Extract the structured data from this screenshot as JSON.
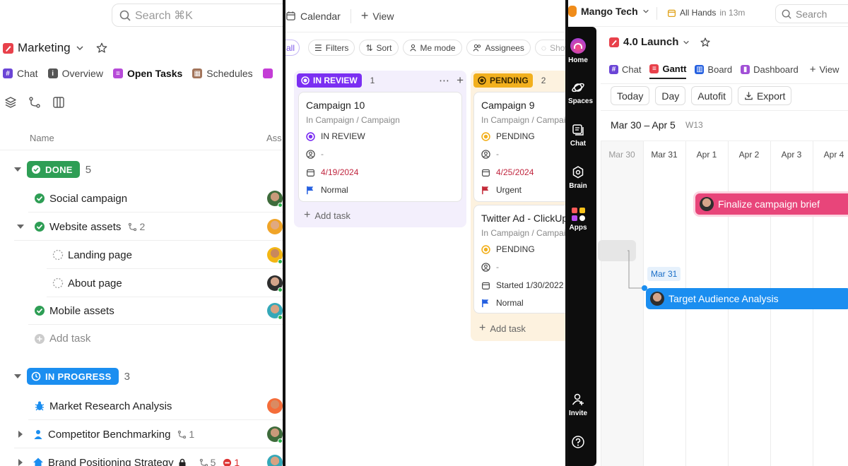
{
  "p1": {
    "search": "Search ⌘K",
    "title": "Marketing",
    "tabs": [
      "Chat",
      "Overview",
      "Open Tasks",
      "Schedules"
    ],
    "col_name": "Name",
    "col_assignee": "Ass",
    "groups": {
      "done": {
        "label": "DONE",
        "count": "5",
        "color": "#2e9e55"
      },
      "inprogress": {
        "label": "IN PROGRESS",
        "count": "3",
        "color": "#1b8ef0"
      }
    },
    "rows": {
      "social": "Social campaign",
      "website": "Website assets",
      "website_sub": "2",
      "landing": "Landing page",
      "about": "About page",
      "mobile": "Mobile assets",
      "add": "Add task",
      "market": "Market Research Analysis",
      "competitor": "Competitor Benchmarking",
      "competitor_sub": "1",
      "brand": "Brand Positioning Strategy",
      "brand_sub": "5",
      "brand_blocked": "1"
    }
  },
  "p2": {
    "view_calendar": "Calendar",
    "view_add": "View",
    "filter_edge": "all",
    "filters": [
      "Filters",
      "Sort",
      "Me mode",
      "Assignees",
      "Show cl"
    ],
    "col1": {
      "status": "IN REVIEW",
      "count": "1",
      "color": "#7b2ff2"
    },
    "col2": {
      "status": "PENDING",
      "count": "2",
      "color": "#f2b01e"
    },
    "card1": {
      "title": "Campaign 10",
      "loc": "In Campaign / Campaign",
      "status": "IN REVIEW",
      "assignee": "-",
      "date": "4/19/2024",
      "priority": "Normal"
    },
    "card2": {
      "title": "Campaign 9",
      "loc": "In Campaign / Campaig",
      "status": "PENDING",
      "assignee": "-",
      "date": "4/25/2024",
      "priority": "Urgent"
    },
    "card3": {
      "title": "Twitter Ad - ClickUp",
      "loc": "In Campaign / Campaig",
      "status": "PENDING",
      "assignee": "-",
      "date": "Started 1/30/2022",
      "priority": "Normal"
    },
    "add_task": "Add task"
  },
  "p3": {
    "workspace": "Mango Tech",
    "meeting": "All Hands",
    "meeting_time": "in 13m",
    "search": "Search",
    "sidebar": [
      "Home",
      "Spaces",
      "Chat",
      "Brain",
      "Apps",
      "Invite"
    ],
    "title": "4.0 Launch",
    "tabs": [
      "Chat",
      "Gantt",
      "Board",
      "Dashboard",
      "View"
    ],
    "buttons": [
      "Today",
      "Day",
      "Autofit",
      "Export"
    ],
    "range": "Mar 30 – Apr 5",
    "week": "W13",
    "days": [
      "Mar 30",
      "Mar 31",
      "Apr 1",
      "Apr 2",
      "Apr 3",
      "Apr 4"
    ],
    "bar1": "Finalize campaign brief",
    "bar2": "Target Audience Analysis",
    "tooltip": "Mar 31"
  }
}
